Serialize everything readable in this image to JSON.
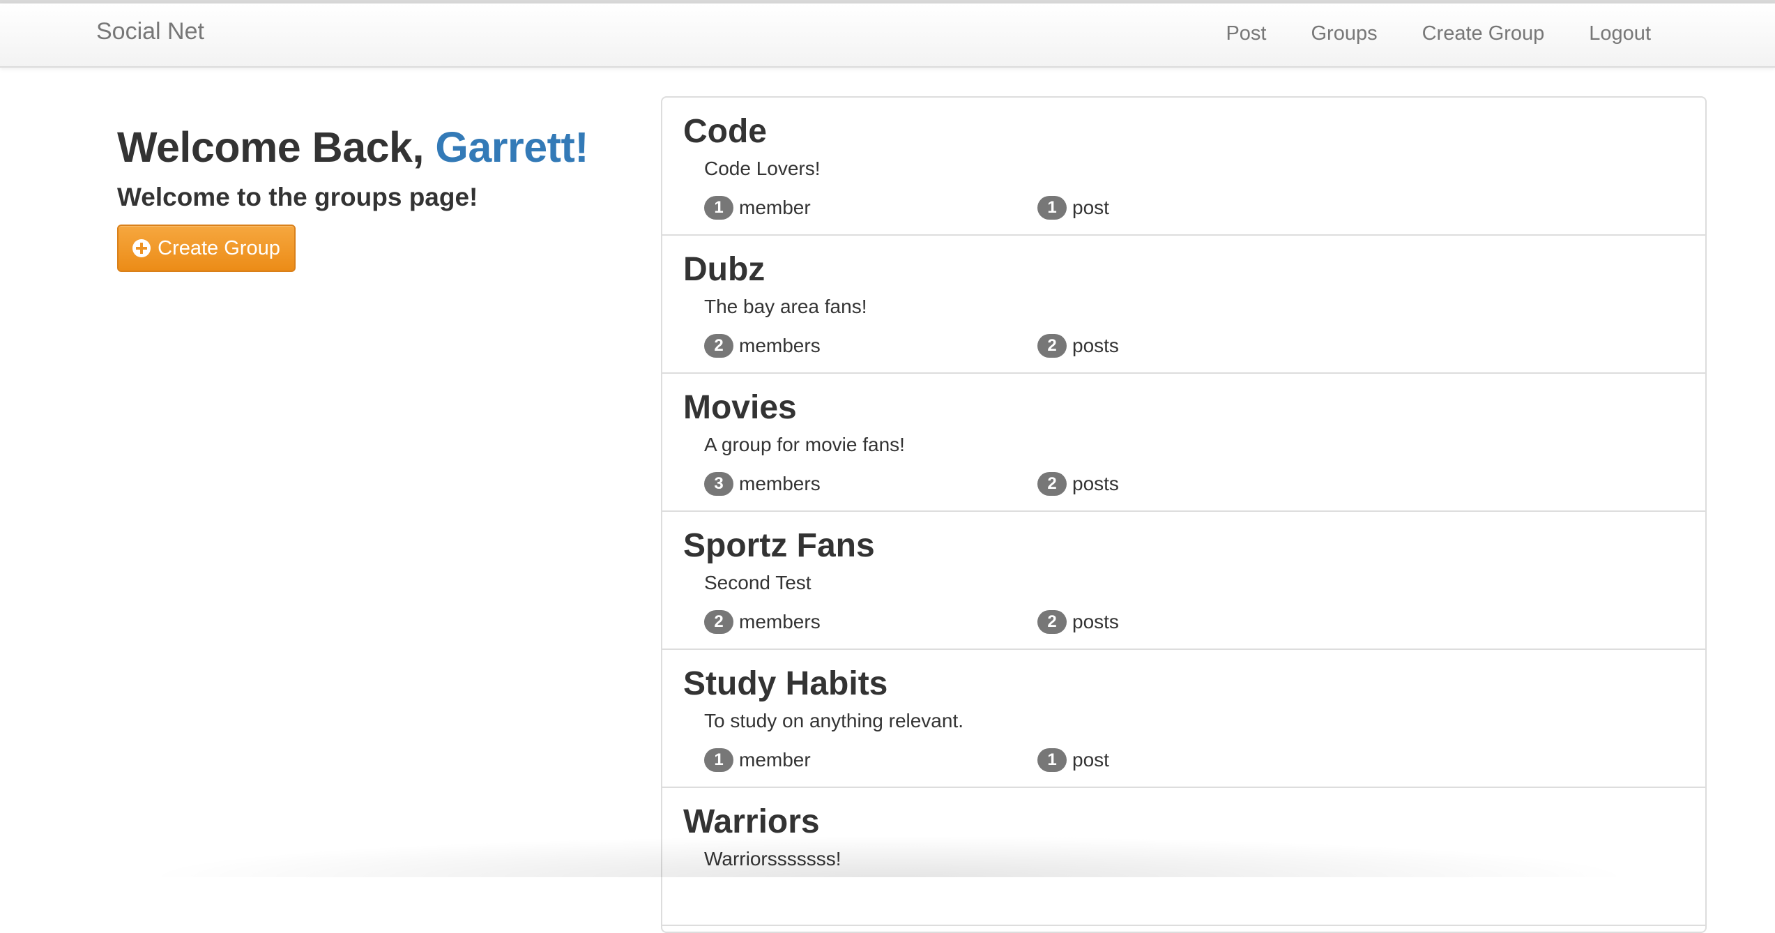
{
  "navbar": {
    "brand": "Social Net",
    "links": [
      "Post",
      "Groups",
      "Create Group",
      "Logout"
    ]
  },
  "welcome": {
    "prefix": "Welcome Back, ",
    "name": "Garrett!",
    "subtitle": "Welcome to the groups page!",
    "create_button_label": "Create Group",
    "create_button_icon": "plus-circle-icon"
  },
  "groups": [
    {
      "name": "Code",
      "description": "Code Lovers!",
      "members_count": "1",
      "members_label": "member",
      "posts_count": "1",
      "posts_label": "post"
    },
    {
      "name": "Dubz",
      "description": "The bay area fans!",
      "members_count": "2",
      "members_label": "members",
      "posts_count": "2",
      "posts_label": "posts"
    },
    {
      "name": "Movies",
      "description": "A group for movie fans!",
      "members_count": "3",
      "members_label": "members",
      "posts_count": "2",
      "posts_label": "posts"
    },
    {
      "name": "Sportz Fans",
      "description": "Second Test",
      "members_count": "2",
      "members_label": "members",
      "posts_count": "2",
      "posts_label": "posts"
    },
    {
      "name": "Study Habits",
      "description": "To study on anything relevant.",
      "members_count": "1",
      "members_label": "member",
      "posts_count": "1",
      "posts_label": "post"
    },
    {
      "name": "Warriors",
      "description": "Warriorsssssss!"
    }
  ],
  "colors": {
    "accent": "#337ab7",
    "button": "#ee9323",
    "badge": "#777777"
  }
}
